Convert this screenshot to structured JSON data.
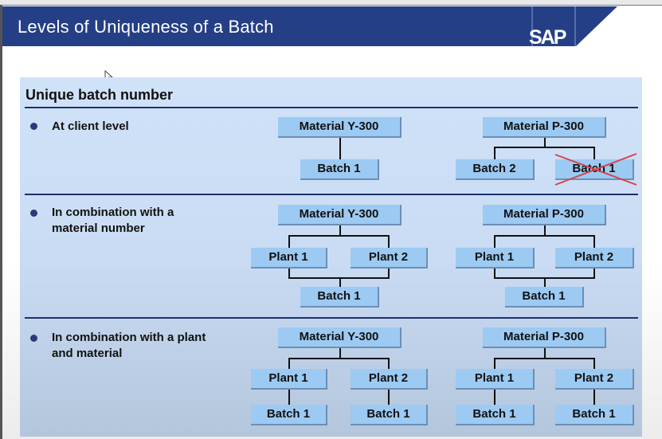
{
  "header": {
    "title": "Levels of Uniqueness of a Batch",
    "logo": "SAP",
    "brand_color": "#253f86"
  },
  "panel": {
    "heading": "Unique batch number",
    "sections": [
      {
        "bullet": "At client level",
        "tree_y": {
          "material": "Material  Y-300",
          "batches": [
            "Batch 1"
          ]
        },
        "tree_p": {
          "material": "Material  P-300",
          "batches": [
            "Batch 2",
            "Batch 1"
          ],
          "crossed_out": "Batch 1"
        }
      },
      {
        "bullet_line1": "In combination with a",
        "bullet_line2": "material number",
        "tree_y": {
          "material": "Material  Y-300",
          "plants": [
            "Plant 1",
            "Plant 2"
          ],
          "batch": "Batch 1"
        },
        "tree_p": {
          "material": "Material  P-300",
          "plants": [
            "Plant 1",
            "Plant 2"
          ],
          "batch": "Batch 1"
        }
      },
      {
        "bullet_line1": "In combination with a plant",
        "bullet_line2": "and material",
        "tree_y": {
          "material": "Material  Y-300",
          "plants": [
            "Plant 1",
            "Plant 2"
          ],
          "batches": [
            "Batch 1",
            "Batch 1"
          ]
        },
        "tree_p": {
          "material": "Material  P-300",
          "plants": [
            "Plant 1",
            "Plant 2"
          ],
          "batches": [
            "Batch 1",
            "Batch 1"
          ]
        }
      }
    ]
  },
  "colors": {
    "box_fill": "#9ccaf2",
    "cross_out": "#d9434a"
  }
}
